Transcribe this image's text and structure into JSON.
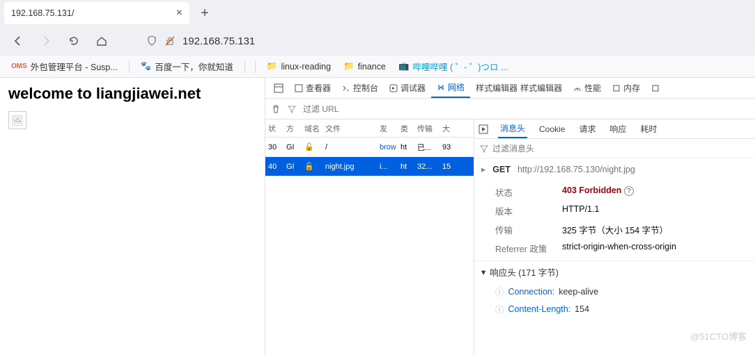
{
  "tab": {
    "title": "192.168.75.131/"
  },
  "url": "192.168.75.131",
  "bookmarks": [
    {
      "label": "外包管理平台 - Susp...",
      "icon": "OMS",
      "color": "#d64"
    },
    {
      "label": "百度一下，你就知道",
      "icon": "baidu"
    },
    {
      "label": "linux-reading",
      "icon": "folder"
    },
    {
      "label": "finance",
      "icon": "folder"
    },
    {
      "label": "哔哩哔哩 ( ゜- ゜)つロ ...",
      "icon": "bili",
      "color": "#00a1d6"
    }
  ],
  "page": {
    "heading": "welcome to liangjiawei.net"
  },
  "devtools": {
    "tabs": [
      "查看器",
      "控制台",
      "调试器",
      "网络",
      "样式编辑器",
      "性能",
      "内存"
    ],
    "activeTab": "网络",
    "filterPlaceholder": "过滤 URL",
    "columns": {
      "status": "状",
      "method": "方",
      "domain": "域名",
      "file": "文件",
      "init": "发",
      "type": "类",
      "transfer": "传输",
      "size": "大"
    }
  },
  "requests": [
    {
      "status": "30",
      "method": "GI",
      "domain": "🔒",
      "file": "/",
      "init": "brow",
      "type": "ht",
      "transfer": "已...",
      "size": "93"
    },
    {
      "status": "40",
      "method": "GI",
      "domain": "🔒",
      "file": "night.jpg",
      "init": "i...",
      "type": "ht",
      "transfer": "32...",
      "size": "15"
    }
  ],
  "detail": {
    "tabs": [
      "消息头",
      "Cookie",
      "请求",
      "响应",
      "耗时"
    ],
    "activeTab": "消息头",
    "filterPlaceholder": "过滤消息头",
    "method": "GET",
    "url": "http://192.168.75.130/night.jpg",
    "headers": {
      "状态": "403 Forbidden",
      "版本": "HTTP/1.1",
      "传输": "325 字节（大小 154 字节）",
      "Referrer 政策": "strict-origin-when-cross-origin"
    },
    "responseHeadersTitle": "响应头 (171 字节)",
    "responseHeaders": [
      {
        "name": "Connection:",
        "value": "keep-alive"
      },
      {
        "name": "Content-Length:",
        "value": "154"
      }
    ]
  },
  "watermark": "@51CTO博客"
}
